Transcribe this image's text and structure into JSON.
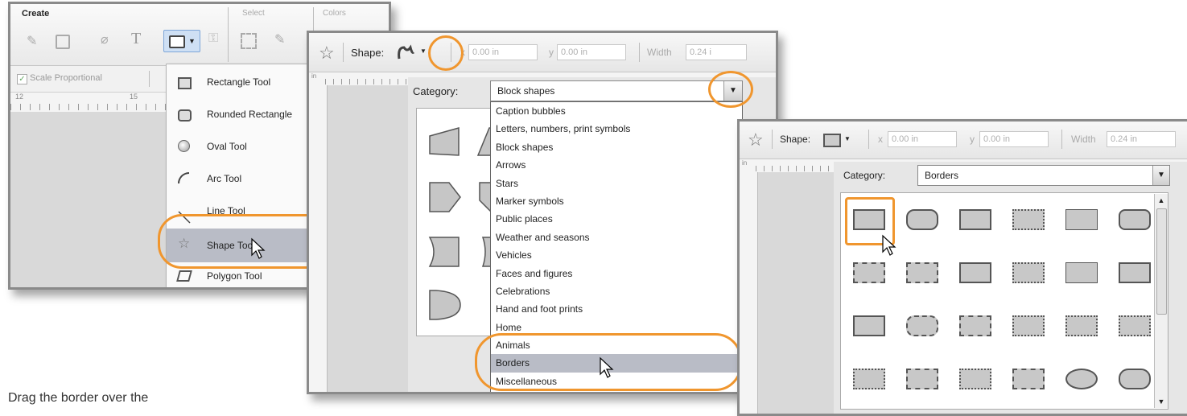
{
  "panel1": {
    "ribbon_groups": [
      "Create",
      "Select",
      "Colors"
    ],
    "scale_label": "Scale Proportional",
    "ruler_ticks": [
      "12",
      "15"
    ],
    "menu_items": [
      "Rectangle Tool",
      "Rounded Rectangle",
      "Oval Tool",
      "Arc Tool",
      "Line Tool",
      "Shape Tool",
      "Polygon Tool"
    ]
  },
  "panel2": {
    "shape_label": "Shape:",
    "x_label": "x",
    "x_value": "0.00 in",
    "y_label": "y",
    "y_value": "0.00 in",
    "width_label": "Width",
    "width_value": "0.24 i",
    "ruler_unit": "in",
    "category_label": "Category:",
    "category_value": "Block shapes",
    "dropdown_options": [
      "Caption bubbles",
      "Letters, numbers, print symbols",
      "Block shapes",
      "Arrows",
      "Stars",
      "Marker symbols",
      "Public places",
      "Weather and seasons",
      "Vehicles",
      "Faces and figures",
      "Celebrations",
      "Hand and foot prints",
      "Home",
      "Animals",
      "Borders",
      "Miscellaneous"
    ],
    "selected_option": "Borders"
  },
  "panel3": {
    "shape_label": "Shape:",
    "x_label": "x",
    "x_value": "0.00 in",
    "y_label": "y",
    "y_value": "0.00 in",
    "width_label": "Width",
    "width_value": "0.24 in",
    "ruler_unit": "in",
    "category_label": "Category:",
    "category_value": "Borders"
  },
  "caption": "Drag the border over the",
  "colors": {
    "accent": "#f0962e",
    "highlight": "#b9bcc6"
  }
}
